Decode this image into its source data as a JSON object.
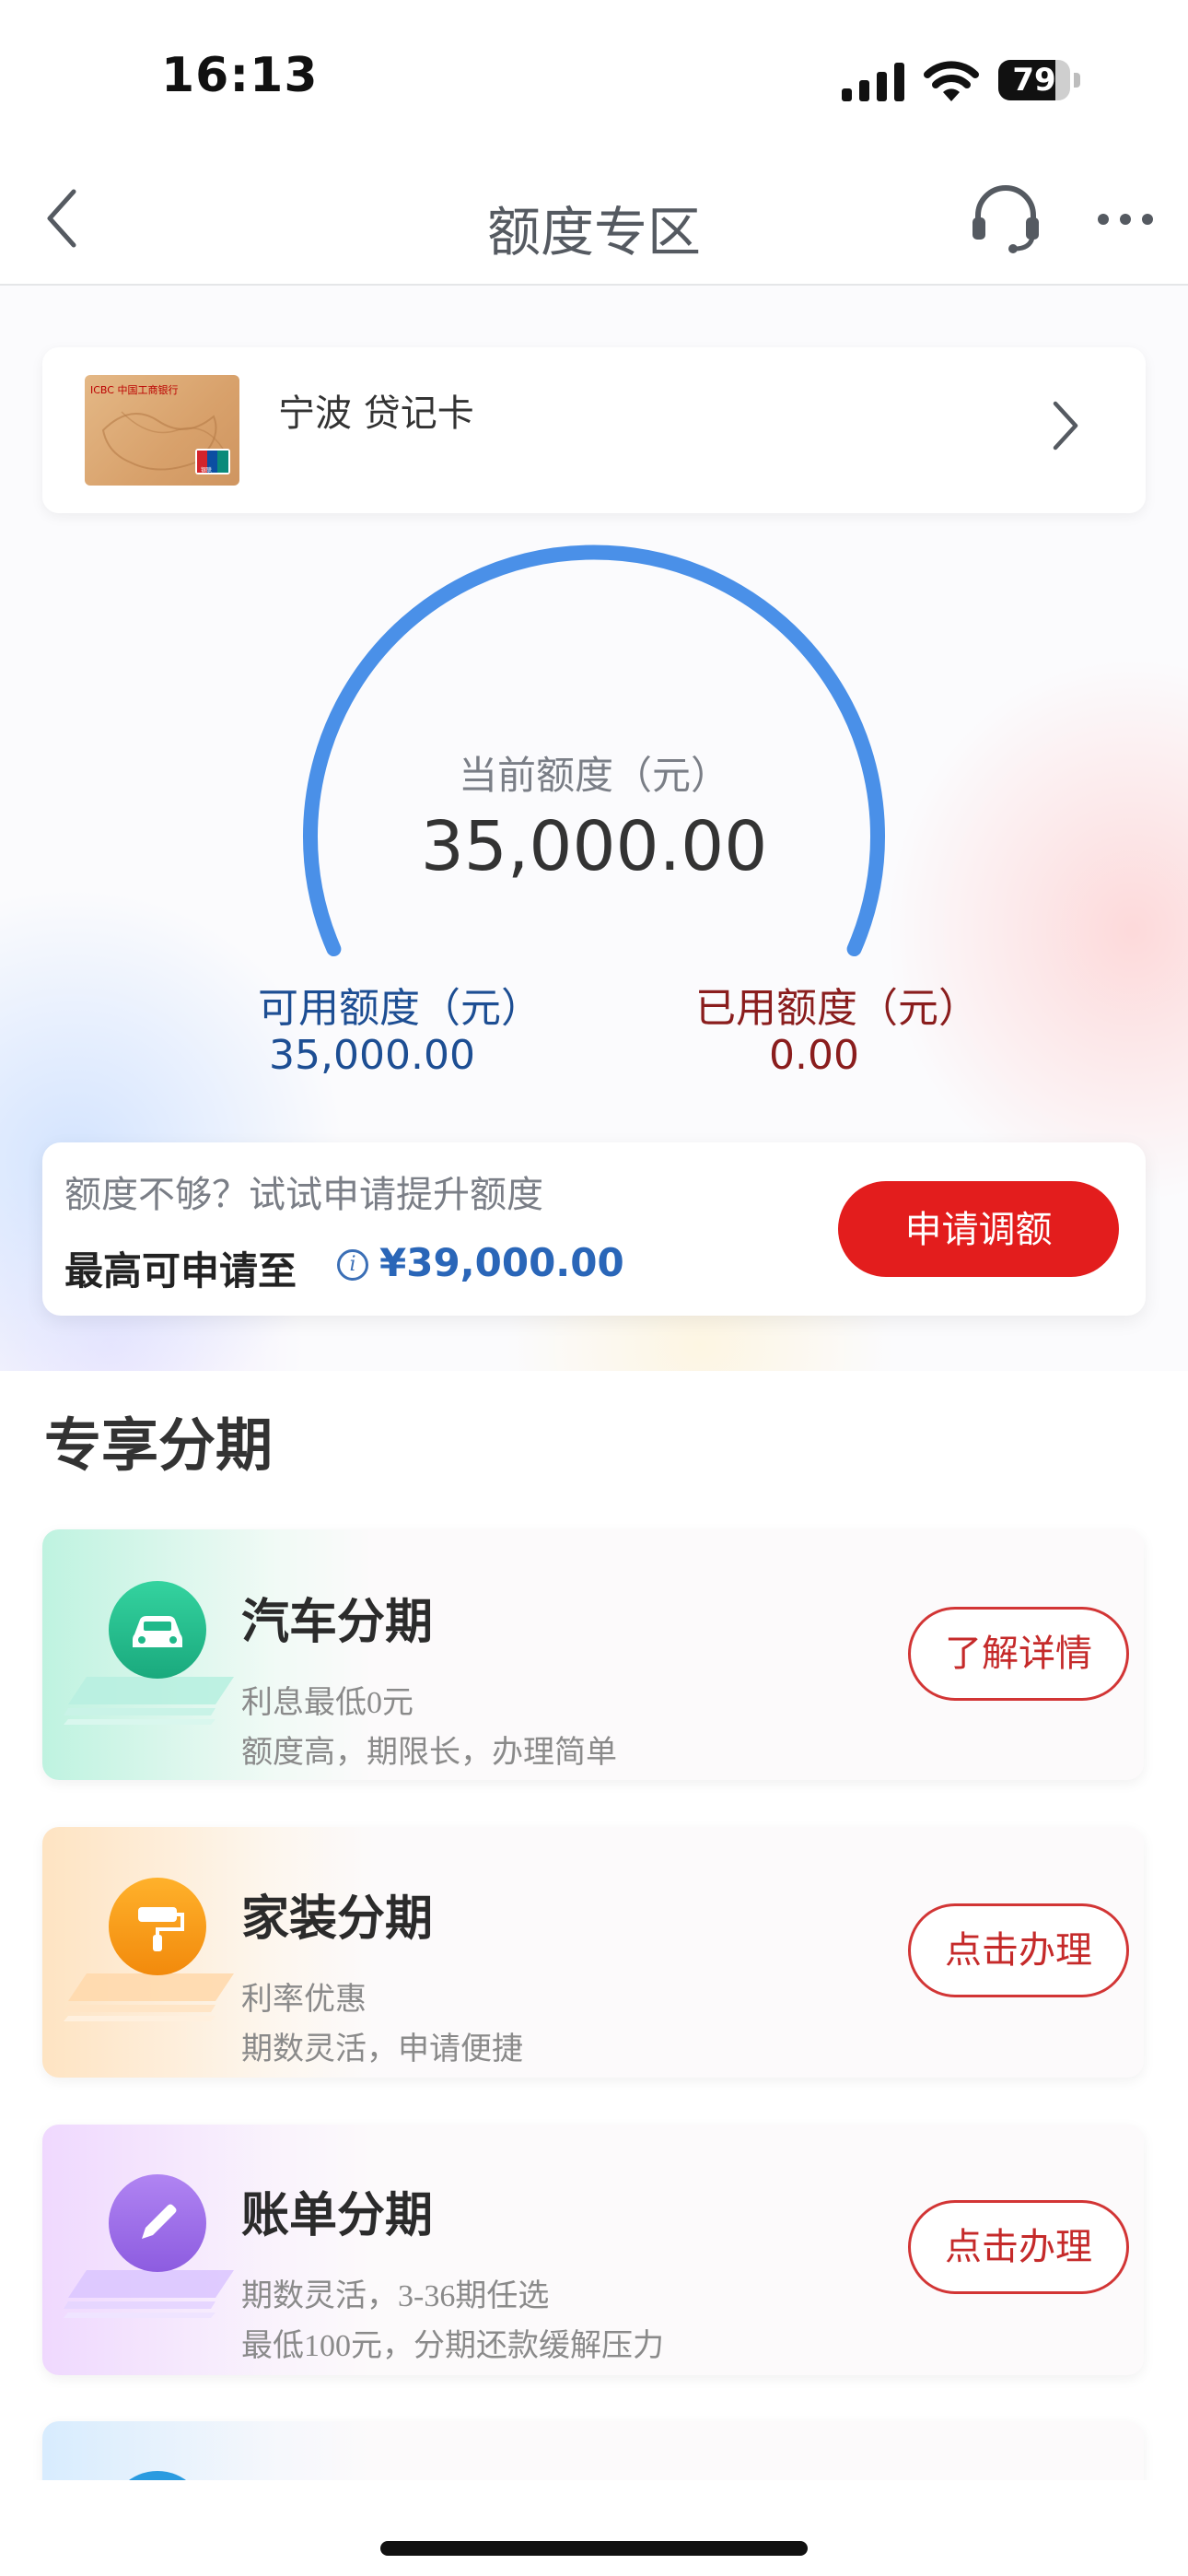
{
  "status_bar": {
    "time": "16:13",
    "battery": "79",
    "battery_level": 0.79
  },
  "nav": {
    "title": "额度专区",
    "back_icon": "chevron-left-icon",
    "service_icon": "headset-icon",
    "more_icon": "more-dots-icon"
  },
  "card": {
    "name": "宁波 贷记卡",
    "bank_text": "ICBC 中国工商银行",
    "brand": "银联"
  },
  "quota": {
    "current_label": "当前额度（元）",
    "current_value": "35,000.00",
    "available_label": "可用额度（元）",
    "available_value": "35,000.00",
    "used_label": "已用额度（元）",
    "used_value": "0.00",
    "used_fraction": 0
  },
  "increase": {
    "hint": "额度不够？试试申请提升额度",
    "max_label": "最高可申请至",
    "info_icon": "i",
    "max_value": "¥39,000.00",
    "button": "申请调额"
  },
  "section": {
    "title": "专享分期"
  },
  "products": [
    {
      "title": "汽车分期",
      "line1": "利息最低0元",
      "line2": "额度高，期限长，办理简单",
      "button": "了解详情",
      "icon": "car-icon",
      "color": "#1fb98a"
    },
    {
      "title": "家装分期",
      "line1": "利率优惠",
      "line2": "期数灵活，申请便捷",
      "button": "点击办理",
      "icon": "paint-roller-icon",
      "color": "#f59a16"
    },
    {
      "title": "账单分期",
      "line1": "期数灵活，3-36期任选",
      "line2": "最低100元，分期还款缓解压力",
      "button": "点击办理",
      "icon": "pencil-icon",
      "color": "#9a67e6"
    }
  ],
  "colors": {
    "accent_red": "#e31d1d",
    "gauge_blue": "#4a90e8",
    "link_blue": "#2a66b8"
  }
}
